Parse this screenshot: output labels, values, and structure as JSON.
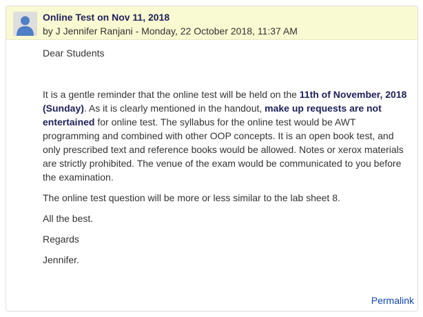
{
  "post": {
    "subject": "Online Test on Nov 11, 2018",
    "author_line": "by J Jennifer Ranjani - Monday, 22 October 2018, 11:37 AM",
    "avatar_icon": "user-avatar-icon",
    "greeting": "Dear Students",
    "paragraph1": {
      "t1": "It is a gentle reminder that the online test will be held on the ",
      "b1": "11th of November, 2018 (Sunday)",
      "t2": ". As it is clearly mentioned in the handout, ",
      "b2": "make up requests are not entertained",
      "t3": " for online test. The syllabus for the online test would be AWT programming and combined with other OOP concepts. It is an open book test, and only prescribed text and reference books would be allowed. Notes or xerox materials are strictly prohibited. The venue of the exam would be communicated to you before the examination."
    },
    "paragraph2": "The online test question will be more or less similar to the lab sheet 8.",
    "closing1": "All the best.",
    "closing2": "Regards",
    "signature": "Jennifer.",
    "permalink": "Permalink"
  },
  "colors": {
    "header_bg": "#fafad2",
    "subject": "#1f1f5a",
    "link": "#0f47ad"
  }
}
